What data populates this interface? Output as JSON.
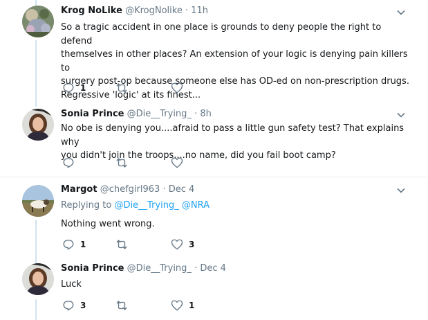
{
  "tweets": [
    {
      "name": "Krog NoLike",
      "handle": "@KrogNolike",
      "sep": "·",
      "time": "11h",
      "lines": [
        "So a tragic accident in one place is grounds to deny people the right to defend",
        "themselves in other places?  An extension of your logic is denying pain killers to",
        "surgery post-op because someone else has OD-ed on non-prescription drugs.",
        "Regressive 'logic' at its finest..."
      ],
      "reply_count": "1",
      "retweet_count": "",
      "like_count": ""
    },
    {
      "name": "Sonia Prince",
      "handle": "@Die__Trying_",
      "sep": "·",
      "time": "8h",
      "lines": [
        "No obe is denying you....afraid to pass a little gun safety test? That explains why",
        "you didn't join the troops....no name, did you fail boot camp?"
      ],
      "reply_count": "",
      "retweet_count": "",
      "like_count": ""
    },
    {
      "name": "Margot",
      "handle": "@chefgirl963",
      "sep": "·",
      "time": "Dec 4",
      "replying_prefix": "Replying to",
      "replying_users": [
        "@Die__Trying_",
        "@NRA"
      ],
      "lines": [
        "Nothing went wrong."
      ],
      "reply_count": "1",
      "retweet_count": "",
      "like_count": "3"
    },
    {
      "name": "Sonia Prince",
      "handle": "@Die__Trying_",
      "sep": "·",
      "time": "Dec 4",
      "lines": [
        "Luck"
      ],
      "reply_count": "3",
      "retweet_count": "",
      "like_count": "1"
    }
  ],
  "colors": {
    "text": "#14171a",
    "muted": "#657786",
    "link": "#1da1f2",
    "thread_line": "#cfe3f2",
    "divider": "#e6ecf0"
  },
  "icons": {
    "reply": "reply-icon",
    "retweet": "retweet-icon",
    "like": "heart-icon",
    "menu": "chevron-down-icon"
  }
}
